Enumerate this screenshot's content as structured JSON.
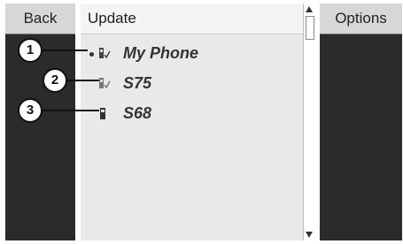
{
  "left_button": {
    "label": "Back"
  },
  "right_button": {
    "label": "Options"
  },
  "list": {
    "title": "Update",
    "items": [
      {
        "label": "My Phone",
        "icon": "phone-authorized-icon",
        "selected": true
      },
      {
        "label": "S75",
        "icon": "phone-authorized-icon",
        "selected": false
      },
      {
        "label": "S68",
        "icon": "phone-icon",
        "selected": false
      }
    ]
  },
  "callouts": [
    "1",
    "2",
    "3"
  ],
  "colors": {
    "panel_dark": "#2b2b2b",
    "list_bg": "#e9e9e9",
    "button_bg": "#d7d7d7"
  }
}
